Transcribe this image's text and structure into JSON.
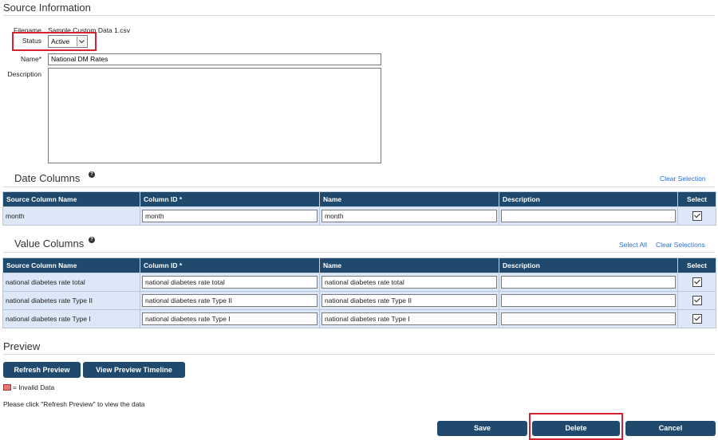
{
  "source_info": {
    "heading": "Source Information",
    "filename_label": "Filename",
    "filename_value": "Sample Custom Data 1.csv",
    "status_label": "Status",
    "status_value": "Active",
    "name_label": "Name*",
    "name_value": "National DM Rates",
    "description_label": "Description",
    "description_value": ""
  },
  "date_columns": {
    "heading": "Date Columns",
    "clear_selection": "Clear Selection",
    "headers": [
      "Source Column Name",
      "Column ID *",
      "Name",
      "Description",
      "Select"
    ],
    "rows": [
      {
        "source": "month",
        "column_id": "month",
        "name": "month",
        "description": "",
        "selected": true
      }
    ]
  },
  "value_columns": {
    "heading": "Value Columns",
    "select_all": "Select All",
    "clear_selections": "Clear Selections",
    "headers": [
      "Source Column Name",
      "Column ID *",
      "Name",
      "Description",
      "Select"
    ],
    "rows": [
      {
        "source": "national diabetes rate total",
        "column_id": "national diabetes rate total",
        "name": "national diabetes rate total",
        "description": "",
        "selected": true
      },
      {
        "source": "national diabetes rate Type II",
        "column_id": "national diabetes rate Type II",
        "name": "national diabetes rate Type II",
        "description": "",
        "selected": true
      },
      {
        "source": "national diabetes rate Type I",
        "column_id": "national diabetes rate Type I",
        "name": "national diabetes rate Type I",
        "description": "",
        "selected": true
      }
    ]
  },
  "preview": {
    "heading": "Preview",
    "refresh_label": "Refresh Preview",
    "timeline_label": "View Preview Timeline",
    "legend_text": "= Invalid Data",
    "hint": "Please click \"Refresh Preview\" to view the data"
  },
  "actions": {
    "save_label": "Save",
    "delete_label": "Delete",
    "cancel_label": "Cancel"
  },
  "colors": {
    "header_bg": "#1f4a6e",
    "row_bg": "#dce8f7",
    "highlight": "#d62230",
    "link": "#2a6fd1"
  }
}
